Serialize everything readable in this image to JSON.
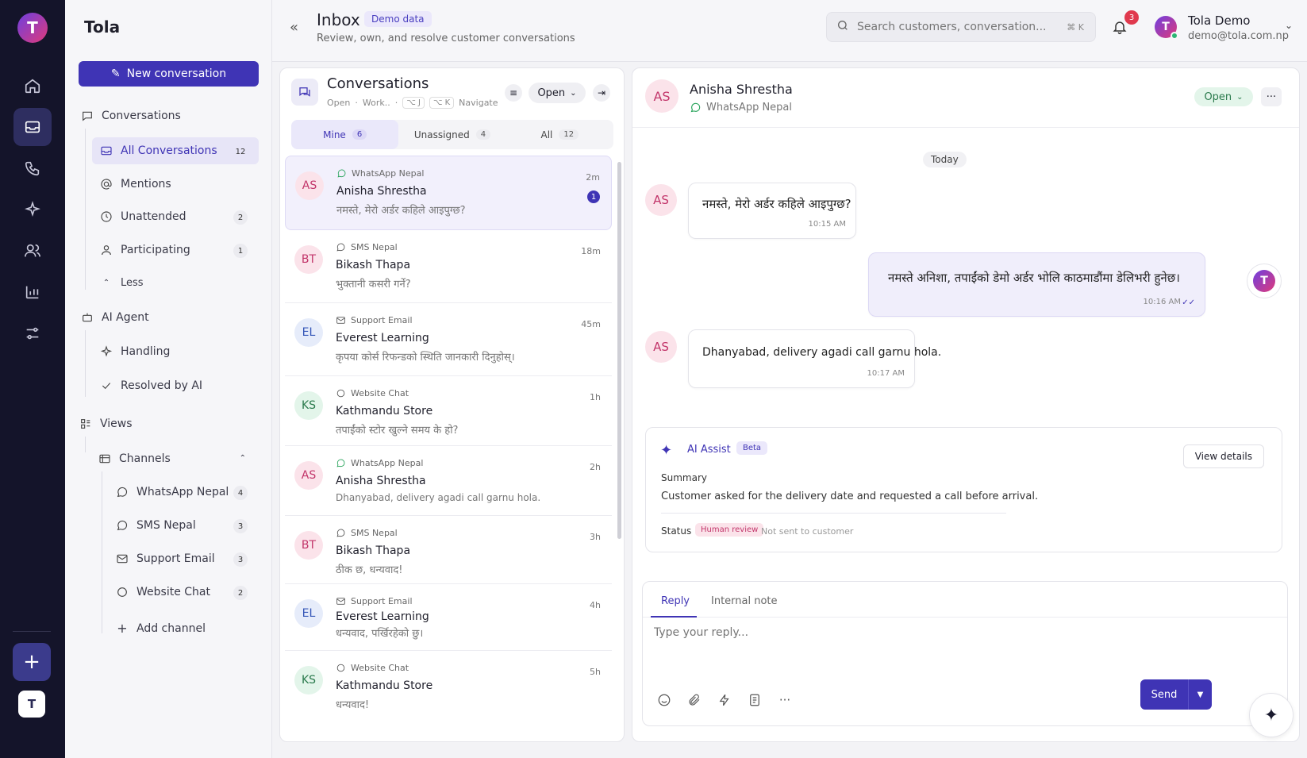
{
  "rail": {
    "logo": "T",
    "bottom_avatar": "T",
    "plus": "+"
  },
  "sidebar": {
    "brand": "Tola",
    "new_conversation": "New conversation",
    "conversations_label": "Conversations",
    "all_conversations": {
      "label": "All Conversations",
      "count": "12"
    },
    "mentions": "Mentions",
    "unattended": {
      "label": "Unattended",
      "count": "2"
    },
    "participating": {
      "label": "Participating",
      "count": "1"
    },
    "less": "Less",
    "ai_agent": "AI Agent",
    "handling": "Handling",
    "resolved_by_ai": "Resolved by AI",
    "views": "Views",
    "channels": "Channels",
    "channel_items": [
      {
        "label": "WhatsApp Nepal",
        "count": "4"
      },
      {
        "label": "SMS Nepal",
        "count": "3"
      },
      {
        "label": "Support Email",
        "count": "3"
      },
      {
        "label": "Website Chat",
        "count": "2"
      }
    ],
    "add_channel": "Add channel"
  },
  "header": {
    "title": "Inbox",
    "demo_badge": "Demo data",
    "subtitle": "Review, own, and resolve customer conversations",
    "search_placeholder": "Search customers, conversation...",
    "search_kbd": "⌘ K",
    "notifications": "3",
    "user_initial": "T",
    "user_name": "Tola Demo",
    "user_email": "demo@tola.com.np"
  },
  "conversations": {
    "title": "Conversations",
    "sub_open": "Open",
    "sub_work": "Work..",
    "kbd1": "⌥ J",
    "kbd2": "⌥ K",
    "navigate": "Navigate",
    "status_filter": "Open",
    "tabs": [
      {
        "label": "Mine",
        "count": "6"
      },
      {
        "label": "Unassigned",
        "count": "4"
      },
      {
        "label": "All",
        "count": "12"
      }
    ],
    "rows": [
      {
        "initials": "AS",
        "channel": "WhatsApp Nepal",
        "name": "Anisha Shrestha",
        "message": "नमस्ते, मेरो अर्डर कहिले आइपुग्छ?",
        "time": "2m",
        "unread": "1"
      },
      {
        "initials": "BT",
        "channel": "SMS Nepal",
        "name": "Bikash Thapa",
        "message": "भुक्तानी कसरी गर्ने?",
        "time": "18m"
      },
      {
        "initials": "EL",
        "channel": "Support Email",
        "name": "Everest Learning",
        "message": "कृपया कोर्स रिफन्डको स्थिति जानकारी दिनुहोस्।",
        "time": "45m"
      },
      {
        "initials": "KS",
        "channel": "Website Chat",
        "name": "Kathmandu Store",
        "message": "तपाईंको स्टोर खुल्ने समय के हो?",
        "time": "1h"
      },
      {
        "initials": "AS",
        "channel": "WhatsApp Nepal",
        "name": "Anisha Shrestha",
        "message": "Dhanyabad, delivery agadi call garnu hola.",
        "time": "2h"
      },
      {
        "initials": "BT",
        "channel": "SMS Nepal",
        "name": "Bikash Thapa",
        "message": "ठीक छ, धन्यवाद!",
        "time": "3h"
      },
      {
        "initials": "EL",
        "channel": "Support Email",
        "name": "Everest Learning",
        "message": "धन्यवाद, पर्खिरहेको छु।",
        "time": "4h"
      },
      {
        "initials": "KS",
        "channel": "Website Chat",
        "name": "Kathmandu Store",
        "message": "धन्यवाद!",
        "time": "5h"
      }
    ]
  },
  "chat": {
    "initials": "AS",
    "name": "Anisha Shrestha",
    "channel": "WhatsApp Nepal",
    "status": "Open",
    "more": "···",
    "today": "Today",
    "messages": [
      {
        "initials": "AS",
        "text": "नमस्ते, मेरो अर्डर कहिले आइपुग्छ?",
        "time": "10:15 AM"
      },
      {
        "text": "नमस्ते अनिशा, तपाईंको डेमो अर्डर भोलि काठमाडौंमा डेलिभरी हुनेछ।",
        "time": "10:16 AM",
        "agent_initial": "T"
      },
      {
        "initials": "AS",
        "text": "Dhanyabad, delivery agadi call garnu hola.",
        "time": "10:17 AM"
      }
    ],
    "ai": {
      "title": "AI Assist",
      "beta": "Beta",
      "view_details": "View details",
      "summary_label": "Summary",
      "summary": "Customer asked for the delivery date and requested a call before arrival.",
      "status_label": "Status",
      "status_badge": "Human review",
      "status_note": "Not sent to customer"
    },
    "reply": {
      "tab_reply": "Reply",
      "tab_note": "Internal note",
      "placeholder": "Type your reply...",
      "send": "Send"
    }
  }
}
